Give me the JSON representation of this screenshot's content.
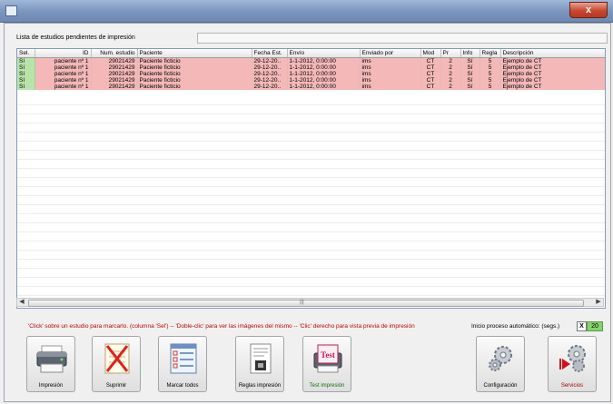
{
  "window": {
    "close_glyph": "x"
  },
  "list": {
    "caption": "Lista de estudios pendientes de impresión",
    "columns": [
      "Sel.",
      "ID",
      "Num. estudio",
      "Paciente",
      "Fecha Est.",
      "Envío",
      "Enviado por",
      "Mod",
      "Pr",
      "Info",
      "Regla",
      "Descripción"
    ],
    "rows": [
      {
        "sel": "Sí",
        "id": "paciente nº 1",
        "num": "29021429",
        "paciente": "Paciente ficticio",
        "fecha": "29-12-20..",
        "envio": "1-1-2012, 0:00:00",
        "enviado_por": "ims",
        "mod": "CT",
        "pr": "2",
        "info": "Sí",
        "regla": "5",
        "desc": "Ejemplo de CT"
      },
      {
        "sel": "Sí",
        "id": "paciente nº 1",
        "num": "29021429",
        "paciente": "Paciente ficticio",
        "fecha": "29-12-20..",
        "envio": "1-1-2012, 0:00:00",
        "enviado_por": "ims",
        "mod": "CT",
        "pr": "2",
        "info": "Sí",
        "regla": "5",
        "desc": "Ejemplo de CT"
      },
      {
        "sel": "Sí",
        "id": "paciente nº 1",
        "num": "29021429",
        "paciente": "Paciente ficticio",
        "fecha": "29-12-20..",
        "envio": "1-1-2012, 0:00:00",
        "enviado_por": "ims",
        "mod": "CT",
        "pr": "2",
        "info": "Sí",
        "regla": "5",
        "desc": "Ejemplo de CT"
      },
      {
        "sel": "Sí",
        "id": "paciente nº 1",
        "num": "29021429",
        "paciente": "Paciente ficticio",
        "fecha": "29-12-20..",
        "envio": "1-1-2012, 0:00:00",
        "enviado_por": "ims",
        "mod": "CT",
        "pr": "2",
        "info": "Sí",
        "regla": "5",
        "desc": "Ejemplo de CT"
      },
      {
        "sel": "Sí",
        "id": "paciente nº 1",
        "num": "29021429",
        "paciente": "Paciente ficticio",
        "fecha": "29-12-20..",
        "envio": "1-1-2012, 0:00:00",
        "enviado_por": "ims",
        "mod": "CT",
        "pr": "2",
        "info": "Sí",
        "regla": "5",
        "desc": "Ejemplo de CT"
      }
    ],
    "row_color": "#f4b8b8",
    "sel_color": "#b9e4a9"
  },
  "status": {
    "hint": "'Click' sobre un estudio para marcarlo. (columna 'Sel') -- 'Doble-clic' para ver las imágenes del mismo -- 'Clic' derecho para vista previa de impresión",
    "auto_label": "Inicio proceso automático: (segs.)",
    "auto_x": "X",
    "auto_value": "20"
  },
  "toolbar": {
    "impresion": "Impresión",
    "suprimir": "Suprimir",
    "marcar_todos": "Marcar todos",
    "reglas_impresion": "Reglas impresión",
    "test_impresion": "Test impresión",
    "test_icon_text": "Test",
    "configuracion": "Configuración",
    "servicios": "Servicios"
  }
}
